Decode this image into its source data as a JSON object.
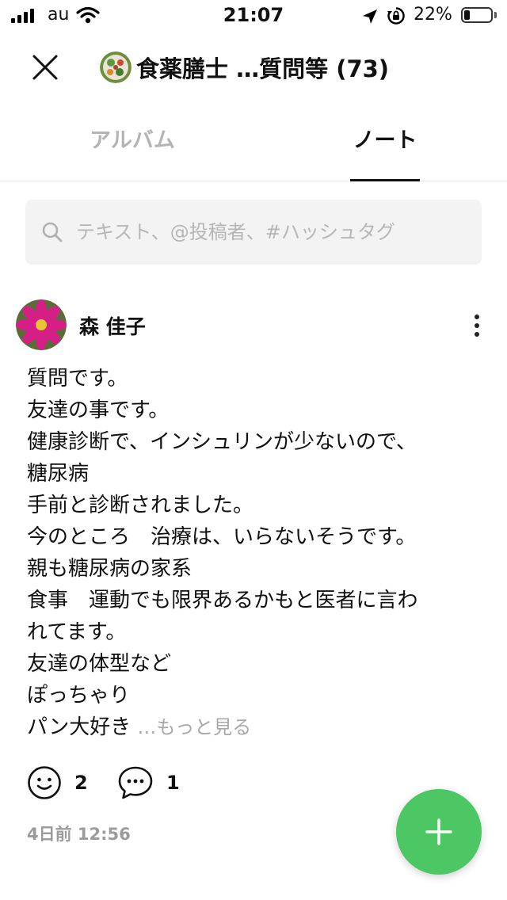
{
  "status_bar": {
    "carrier": "au",
    "time": "21:07",
    "battery_percent": "22%",
    "battery_level": 0.22
  },
  "header": {
    "title": "食薬膳士 …質問等 (73)"
  },
  "tabs": [
    {
      "label": "アルバム",
      "active": false
    },
    {
      "label": "ノート",
      "active": true
    }
  ],
  "search": {
    "placeholder": "テキスト、@投稿者、#ハッシュタグ",
    "value": ""
  },
  "post": {
    "author": "森 佳子",
    "lines": [
      "質問です。",
      "友達の事です。",
      "健康診断で、インシュリンが少ないので、",
      "糖尿病",
      "手前と診断されました。",
      "今のところ　治療は、いらないそうです。",
      "親も糖尿病の家系",
      "食事　運動でも限界あるかもと医者に言わ",
      "れてます。",
      "友達の体型など",
      "ぽっちゃり",
      "パン大好き"
    ],
    "see_more": "…もっと見る",
    "like_count": "2",
    "comment_count": "1",
    "time": "4日前 12:56"
  },
  "colors": {
    "accent_green": "#4cc764",
    "inactive_tab": "#b4b4b4",
    "placeholder": "#b6b6b6"
  },
  "icons": {
    "close": "close-icon",
    "search": "search-icon",
    "more": "more-vertical-icon",
    "like": "smiley-icon",
    "comment": "comment-icon",
    "add": "plus-icon"
  }
}
